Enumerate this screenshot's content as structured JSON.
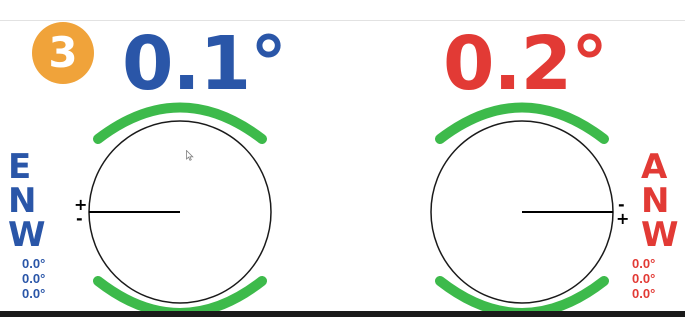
{
  "step_badge": "3",
  "left_gauge": {
    "reading": "0.1°",
    "color": "#2a56a8",
    "label_letters": [
      "E",
      "N",
      "W"
    ],
    "values": [
      "0.0°",
      "0.0°",
      "0.0°"
    ],
    "sign_top": "+",
    "sign_bottom": "-"
  },
  "right_gauge": {
    "reading": "0.2°",
    "color": "#e23a35",
    "label_letters": [
      "A",
      "N",
      "W"
    ],
    "values": [
      "0.0°",
      "0.0°",
      "0.0°"
    ],
    "sign_top": "-",
    "sign_bottom": "+"
  },
  "colors": {
    "badge": "#f0a33a",
    "arc_green": "#3dba4b",
    "needle": "#000000"
  },
  "icons": {
    "cursor": "mouse-pointer-icon"
  },
  "status_bar": {
    "item_1": "",
    "item_2": "",
    "item_3": "",
    "item_4": ""
  }
}
